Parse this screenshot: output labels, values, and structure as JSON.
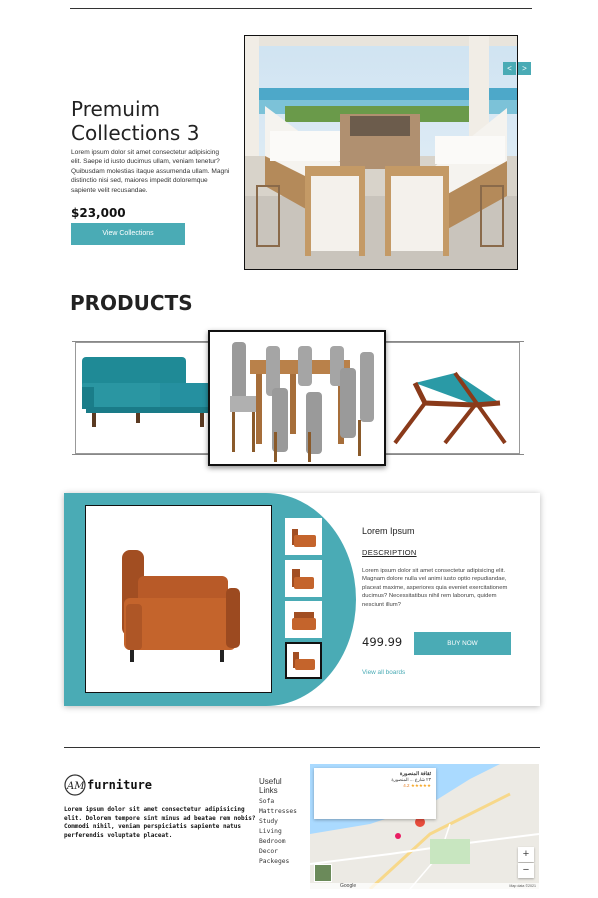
{
  "hero": {
    "title": "Premuim Collections 3",
    "text": "Lorem ipsum dolor sit amet consectetur adipisicing elit. Saepe id iusto ducimus ullam, veniam tenetur? Quibusdam molestias itaque assumenda ullam. Magni distinctio nisi sed, maiores impedit doloremque sapiente velit recusandae.",
    "price": "$23,000",
    "button": "View Collections",
    "prev": "<",
    "next": ">"
  },
  "products": {
    "title": "PRODUCTS"
  },
  "detail": {
    "title": "Lorem Ipsum",
    "desc_head": "DESCRIPTION",
    "text": "Lorem ipsum dolor sit amet consectetur adipisicing elit. Magnam dolore nulla vel animi iusto optio repudiandae, placeat maxime, asperiores quia eveniet exercitationem ducimus? Necessitatibus nihil rem laborum, quidem nesciunt illum?",
    "price": "499.99",
    "buy": "BUY NOW",
    "link": "View all boards"
  },
  "footer": {
    "logo_mark": "AM",
    "logo_text": "furniture",
    "text": "Lorem ipsum dolor sit amet consectetur adipisicing elit. Dolorem tempore sint minus ad beatae rem nobis? Commodi nihil, veniam perspiciatis sapiente natus perferendis voluptate placeat.",
    "links_title": "Useful Links",
    "links": [
      "Sofa",
      "Mattresses",
      "Study",
      "Living",
      "Bedroom",
      "Decor",
      "Packeges"
    ]
  },
  "map": {
    "place_name": "ثقافة المنصورة",
    "address": "٢٣ شارع ... المنصورة",
    "rating": "4.2",
    "stars": "★★★★★",
    "zoom_in": "+",
    "zoom_out": "−",
    "google": "Google",
    "map_data": "Map data ©2021"
  },
  "colors": {
    "accent": "#4aabb5"
  }
}
